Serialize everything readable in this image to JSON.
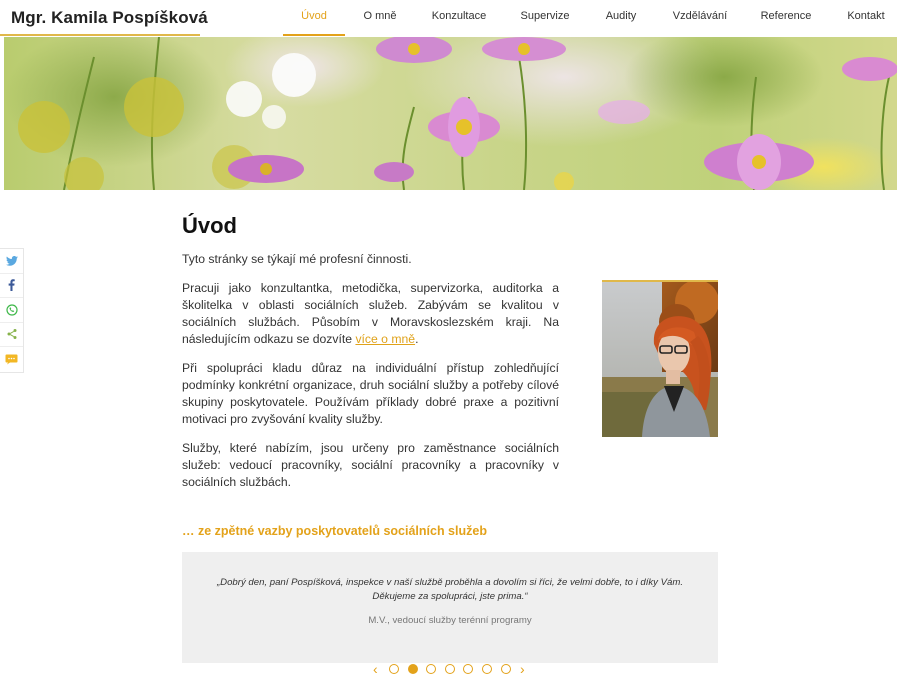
{
  "header": {
    "site_title": "Mgr. Kamila Pospíšková",
    "nav": [
      "Úvod",
      "O mně",
      "Konzultace",
      "Supervize",
      "Audity",
      "Vzdělávání",
      "Reference",
      "Kontakt"
    ],
    "active_nav": "Úvod"
  },
  "share": {
    "icons": [
      "twitter-icon",
      "facebook-icon",
      "whatsapp-icon",
      "share-icon",
      "sms-icon"
    ]
  },
  "main": {
    "title": "Úvod",
    "paragraphs": {
      "p1": "Tyto stránky se týkají mé profesní činnosti.",
      "p2": "Pracuji jako konzultantka, metodička, supervizorka, auditorka a školitelka v oblasti sociálních služeb. Zabývám se kvalitou v sociálních službách. Působím v Moravskoslezském kraji. Na následujícím odkazu se dozvíte ",
      "p2_link": "více o mně",
      "p2_end": ".",
      "p3": "Při spolupráci kladu důraz na individuální přístup zohledňující podmínky konkrétní organizace, druh sociální služby a potřeby cílové skupiny poskytovatele. Používám příklady dobré praxe a pozitivní motivaci pro zvyšování kvality služby.",
      "p4": "Služby, které nabízím, jsou určeny pro zaměstnance sociálních služeb: vedoucí pracovníky, sociální pracovníky a pracovníky v sociálních službách."
    }
  },
  "feedback": {
    "title": "… ze zpětné vazby poskytovatelů sociálních služeb",
    "quote": "„Dobrý den, paní Pospíšková, inspekce v naší službě proběhla a dovolím si říci, že velmi dobře, to i díky Vám. Děkujeme za spolupráci, jste prima.“",
    "author": "M.V., vedoucí služby terénní programy"
  },
  "carousel": {
    "prev": "‹",
    "next": "›",
    "slide_count": 7,
    "active_slide": 2
  },
  "colors": {
    "accent": "#e3a21a",
    "testimonial_bg": "#efefef"
  }
}
